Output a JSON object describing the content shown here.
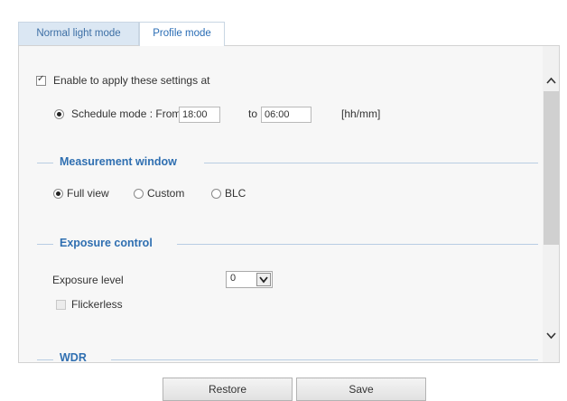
{
  "tabs": [
    {
      "label": "Normal light mode",
      "active": false
    },
    {
      "label": "Profile mode",
      "active": true
    }
  ],
  "enable": {
    "label": "Enable to apply these settings at",
    "checked": true
  },
  "schedule": {
    "label": "Schedule mode : From",
    "selected": true,
    "from_value": "18:00",
    "to_label": "to",
    "to_value": "06:00",
    "unit": "[hh/mm]"
  },
  "measurement": {
    "title": "Measurement window",
    "options": [
      {
        "label": "Full view",
        "selected": true
      },
      {
        "label": "Custom",
        "selected": false
      },
      {
        "label": "BLC",
        "selected": false
      }
    ]
  },
  "exposure": {
    "title": "Exposure control",
    "level_label": "Exposure level",
    "level_value": "0",
    "flickerless_label": "Flickerless",
    "flickerless_checked": false
  },
  "next_section_title": "WDR",
  "buttons": {
    "restore": "Restore",
    "save": "Save"
  },
  "colors": {
    "accent": "#2f6fb1",
    "tab_inactive_bg": "#dbe7f3",
    "panel_bg": "#f7f7f7"
  }
}
